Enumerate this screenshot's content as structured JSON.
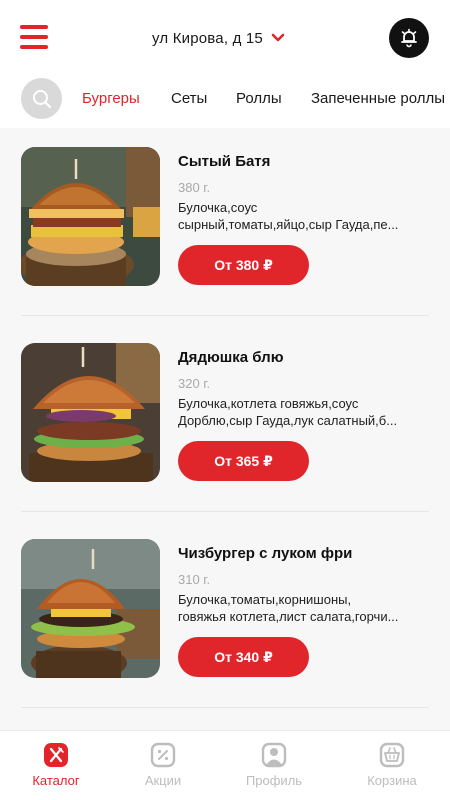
{
  "header": {
    "menu_icon": "hamburger-menu-icon",
    "address": "ул Кирова, д 15",
    "address_icon": "chevron-down-icon",
    "bell_icon": "alarm-bell-icon"
  },
  "categories": {
    "search_icon": "search-icon",
    "items": [
      {
        "label": "Бургеры",
        "active": true
      },
      {
        "label": "Сеты",
        "active": false
      },
      {
        "label": "Роллы",
        "active": false
      },
      {
        "label": "Запеченные роллы",
        "active": false
      }
    ]
  },
  "products": [
    {
      "name": "Сытый Батя",
      "weight": "380 г.",
      "desc_line1": "Булочка,соус",
      "desc_line2": "сырный,томаты,яйцо,сыр Гауда,пе...",
      "price": "От 380 ₽"
    },
    {
      "name": "Дядюшка блю",
      "weight": "320 г.",
      "desc_line1": "Булочка,котлета говяжья,соус",
      "desc_line2": "Дорблю,сыр Гауда,лук салатный,б...",
      "price": "От 365 ₽"
    },
    {
      "name": "Чизбургер с луком фри",
      "weight": "310 г.",
      "desc_line1": "Булочка,томаты,корнишоны,",
      "desc_line2": "говяжья котлета,лист салата,горчи...",
      "price": "От 340 ₽"
    }
  ],
  "tabbar": {
    "items": [
      {
        "label": "Каталог",
        "icon": "catalog-fork-knife-icon",
        "active": true
      },
      {
        "label": "Акции",
        "icon": "discount-percent-icon",
        "active": false
      },
      {
        "label": "Профиль",
        "icon": "profile-user-icon",
        "active": false
      },
      {
        "label": "Корзина",
        "icon": "cart-basket-icon",
        "active": false
      }
    ]
  },
  "colors": {
    "accent": "#e1262b",
    "inactive": "#bdbdbd",
    "dark": "#111111"
  }
}
